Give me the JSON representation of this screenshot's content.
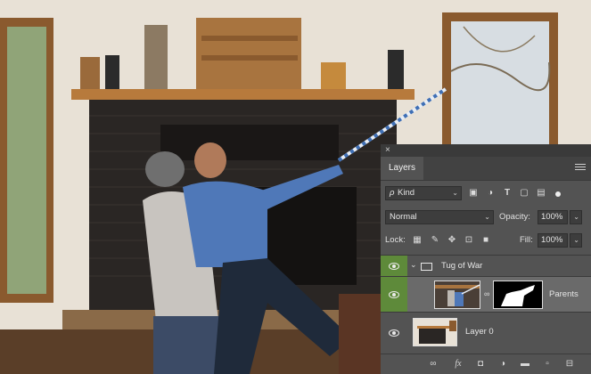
{
  "panel": {
    "close_glyph": "×",
    "tab_label": "Layers",
    "filter": {
      "search_glyph": "ρ",
      "kind_label": "Kind",
      "caret": "⌄"
    },
    "blend": {
      "mode": "Normal",
      "caret": "⌄",
      "opacity_label": "Opacity:",
      "opacity_value": "100%"
    },
    "lock": {
      "label": "Lock:",
      "fill_label": "Fill:",
      "fill_value": "100%"
    },
    "layers": [
      {
        "name": "Tug of War",
        "type": "group",
        "expanded": true,
        "visible": true
      },
      {
        "name": "Parents",
        "type": "layer-with-mask",
        "visible": true,
        "selected": true
      },
      {
        "name": "Layer 0",
        "type": "layer",
        "visible": true
      }
    ],
    "footer_icons": [
      "link-icon",
      "fx-icon",
      "mask-icon",
      "adjustment-icon",
      "folder-icon",
      "new-layer-icon",
      "trash-icon"
    ],
    "footer_fx": "fx",
    "colors": {
      "panel_bg": "#535353",
      "selected_row": "#6a6a6a",
      "eye_cell_active": "#5e8a3a"
    }
  }
}
